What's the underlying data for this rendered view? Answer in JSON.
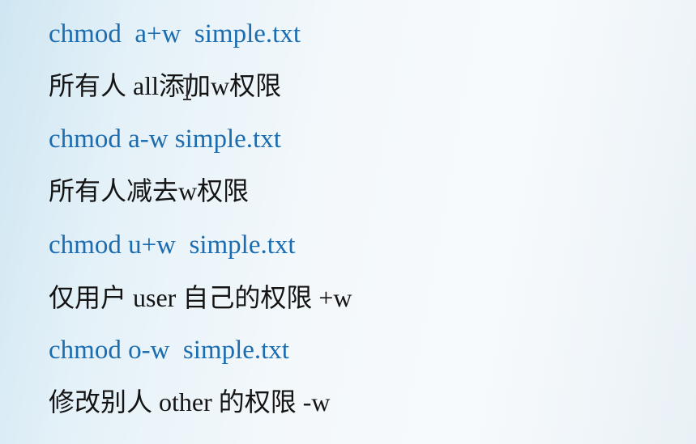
{
  "lines": [
    {
      "kind": "command",
      "text": "chmod  a+w  simple.txt"
    },
    {
      "kind": "description",
      "text": "所有人 all添加w权限"
    },
    {
      "kind": "command",
      "text": "chmod a-w simple.txt"
    },
    {
      "kind": "description",
      "text": "所有人减去w权限"
    },
    {
      "kind": "command",
      "text": "chmod u+w  simple.txt"
    },
    {
      "kind": "description",
      "text": "仅用户 user 自己的权限 +w"
    },
    {
      "kind": "command",
      "text": "chmod o-w  simple.txt"
    },
    {
      "kind": "description",
      "text": "修改别人 other 的权限 -w"
    }
  ],
  "colors": {
    "command": "#1c6cb0",
    "description": "#141414"
  }
}
